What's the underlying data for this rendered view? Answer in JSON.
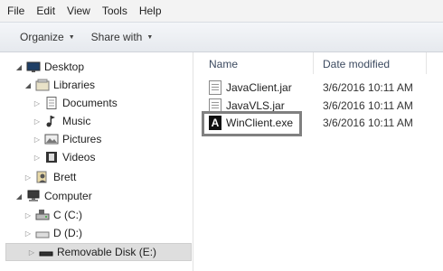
{
  "menu": [
    "File",
    "Edit",
    "View",
    "Tools",
    "Help"
  ],
  "toolbar": {
    "organize": "Organize",
    "share_with": "Share with"
  },
  "tree": [
    {
      "label": "Desktop",
      "icon": "desktop-icon",
      "state": "expanded"
    },
    {
      "label": "Libraries",
      "icon": "libraries-icon",
      "state": "expanded"
    },
    {
      "label": "Documents",
      "icon": "documents-icon",
      "state": "collapsed"
    },
    {
      "label": "Music",
      "icon": "music-icon",
      "state": "collapsed"
    },
    {
      "label": "Pictures",
      "icon": "pictures-icon",
      "state": "collapsed"
    },
    {
      "label": "Videos",
      "icon": "videos-icon",
      "state": "collapsed"
    },
    {
      "label": "Brett",
      "icon": "user-folder-icon",
      "state": "collapsed"
    },
    {
      "label": "Computer",
      "icon": "computer-icon",
      "state": "expanded"
    },
    {
      "label": "C (C:)",
      "icon": "drive-icon",
      "state": "collapsed"
    },
    {
      "label": "D (D:)",
      "icon": "drive-icon",
      "state": "collapsed"
    },
    {
      "label": "Removable Disk (E:)",
      "icon": "removable-disk-icon",
      "state": "collapsed",
      "selected": true
    }
  ],
  "columns": {
    "name": "Name",
    "date_modified": "Date modified"
  },
  "files": [
    {
      "name": "JavaClient.jar",
      "date": "3/6/2016 10:11 AM",
      "icon": "jar-file-icon"
    },
    {
      "name": "JavaVLS.jar",
      "date": "3/6/2016 10:11 AM",
      "icon": "jar-file-icon"
    },
    {
      "name": "WinClient.exe",
      "date": "3/6/2016 10:11 AM",
      "icon": "exe-app-icon",
      "highlighted": true
    }
  ],
  "exe_icon_glyph": "A"
}
